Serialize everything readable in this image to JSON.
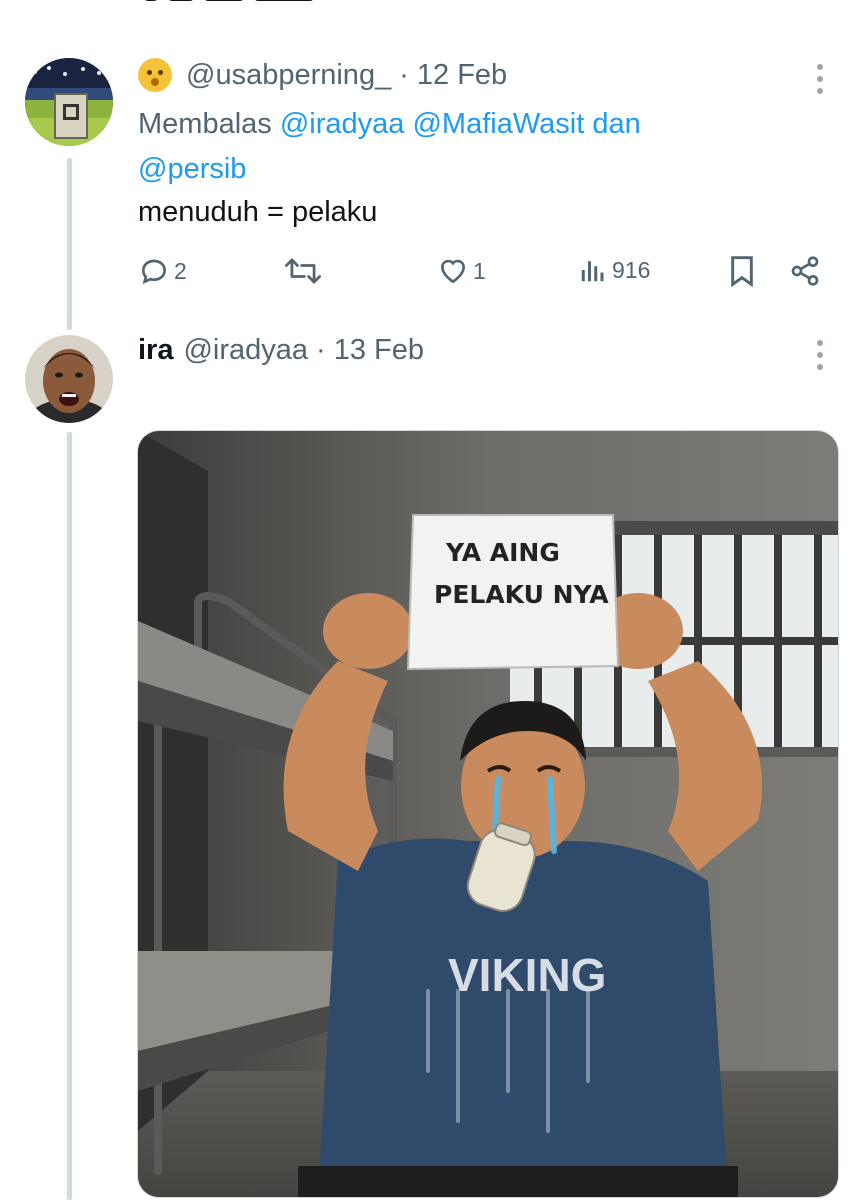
{
  "tweets": [
    {
      "author_name": "",
      "handle": "@usabperning_",
      "dot": "·",
      "date": "12 Feb",
      "reply_prefix": "Membalas",
      "reply_mentions": [
        "@iradyaa",
        "@MafiaWasit"
      ],
      "reply_joiner": "dan",
      "reply_last": "@persib",
      "text": "menuduh = pelaku",
      "stats": {
        "replies": "2",
        "retweets": "",
        "likes": "1",
        "views": "916"
      }
    },
    {
      "author_name": "ira",
      "handle": "@iradyaa",
      "dot": "·",
      "date": "13 Feb",
      "media": {
        "sign_line1": "YA AING",
        "sign_line2": "PELAKU NYA",
        "shirt_text": "VIKING"
      }
    }
  ],
  "icons": {
    "reply": "reply-icon",
    "retweet": "retweet-icon",
    "like": "heart-icon",
    "views": "views-icon",
    "bookmark": "bookmark-icon",
    "share": "share-icon",
    "more": "more-icon"
  },
  "colors": {
    "link": "#1d9bf0",
    "muted": "#536471",
    "line": "#cfd9de"
  }
}
